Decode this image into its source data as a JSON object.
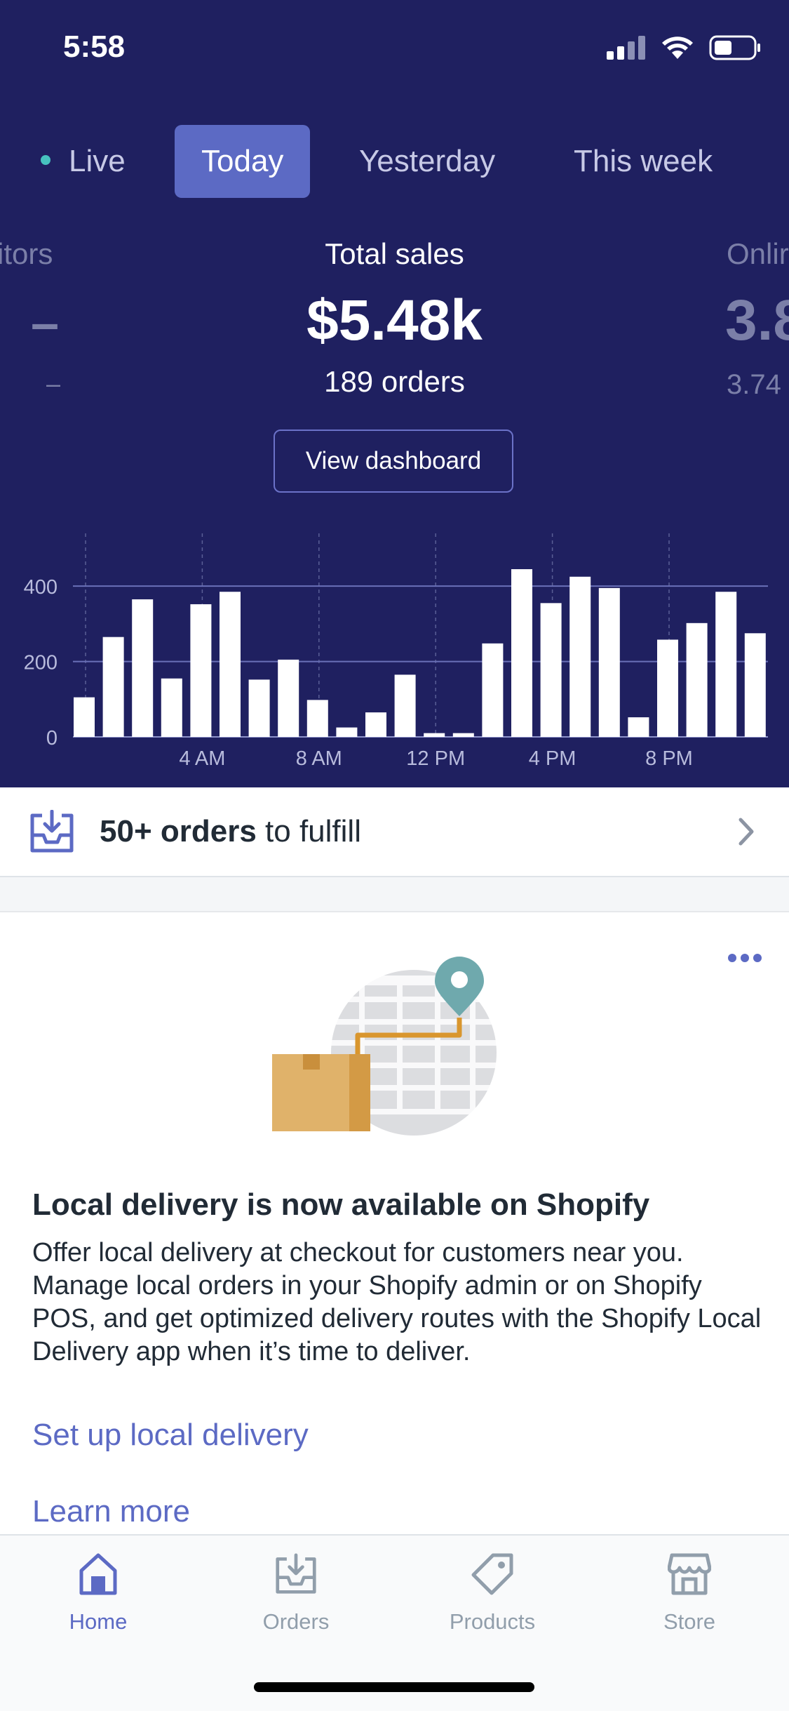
{
  "status_bar": {
    "time": "5:58"
  },
  "period_tabs": [
    {
      "label": "Live",
      "active": false
    },
    {
      "label": "Today",
      "active": true
    },
    {
      "label": "Yesterday",
      "active": false
    },
    {
      "label": "This week",
      "active": false
    }
  ],
  "metrics": {
    "left_partial": {
      "label": "itors",
      "value": "–",
      "sub": "–"
    },
    "center": {
      "label": "Total sales",
      "value": "$5.48k",
      "sub": "189 orders"
    },
    "right_partial": {
      "label": "Onlir",
      "value": "3.8",
      "sub": "3.74"
    }
  },
  "dashboard_button": "View dashboard",
  "chart_data": {
    "type": "bar",
    "x_tick_labels": [
      "4 AM",
      "8 AM",
      "12 PM",
      "4 PM",
      "8 PM"
    ],
    "y_tick_labels": [
      "400",
      "200",
      "0"
    ],
    "ylim": [
      0,
      540
    ],
    "values": [
      105,
      265,
      365,
      155,
      352,
      385,
      152,
      205,
      98,
      25,
      65,
      165,
      10,
      10,
      248,
      445,
      355,
      425,
      395,
      52,
      258,
      302,
      385,
      275
    ]
  },
  "fulfill": {
    "count": "50+ orders",
    "suffix": " to fulfill"
  },
  "card": {
    "title": "Local delivery is now available on Shopify",
    "body": "Offer local delivery at checkout for customers near you. Manage local orders in your Shopify admin or on Shopify POS, and get optimized delivery routes with the Shopify Local Delivery app when it’s time to deliver.",
    "primary_link": "Set up local delivery",
    "secondary_link": "Learn more"
  },
  "tab_bar": [
    {
      "label": "Home",
      "icon": "home-icon",
      "active": true
    },
    {
      "label": "Orders",
      "icon": "orders-icon",
      "active": false
    },
    {
      "label": "Products",
      "icon": "products-icon",
      "active": false
    },
    {
      "label": "Store",
      "icon": "store-icon",
      "active": false
    }
  ],
  "colors": {
    "hero_bg": "#1f2060",
    "accent": "#5c6ac4",
    "live_dot": "#47c1bf",
    "text_dark": "#212b36",
    "muted": "#919eab"
  }
}
